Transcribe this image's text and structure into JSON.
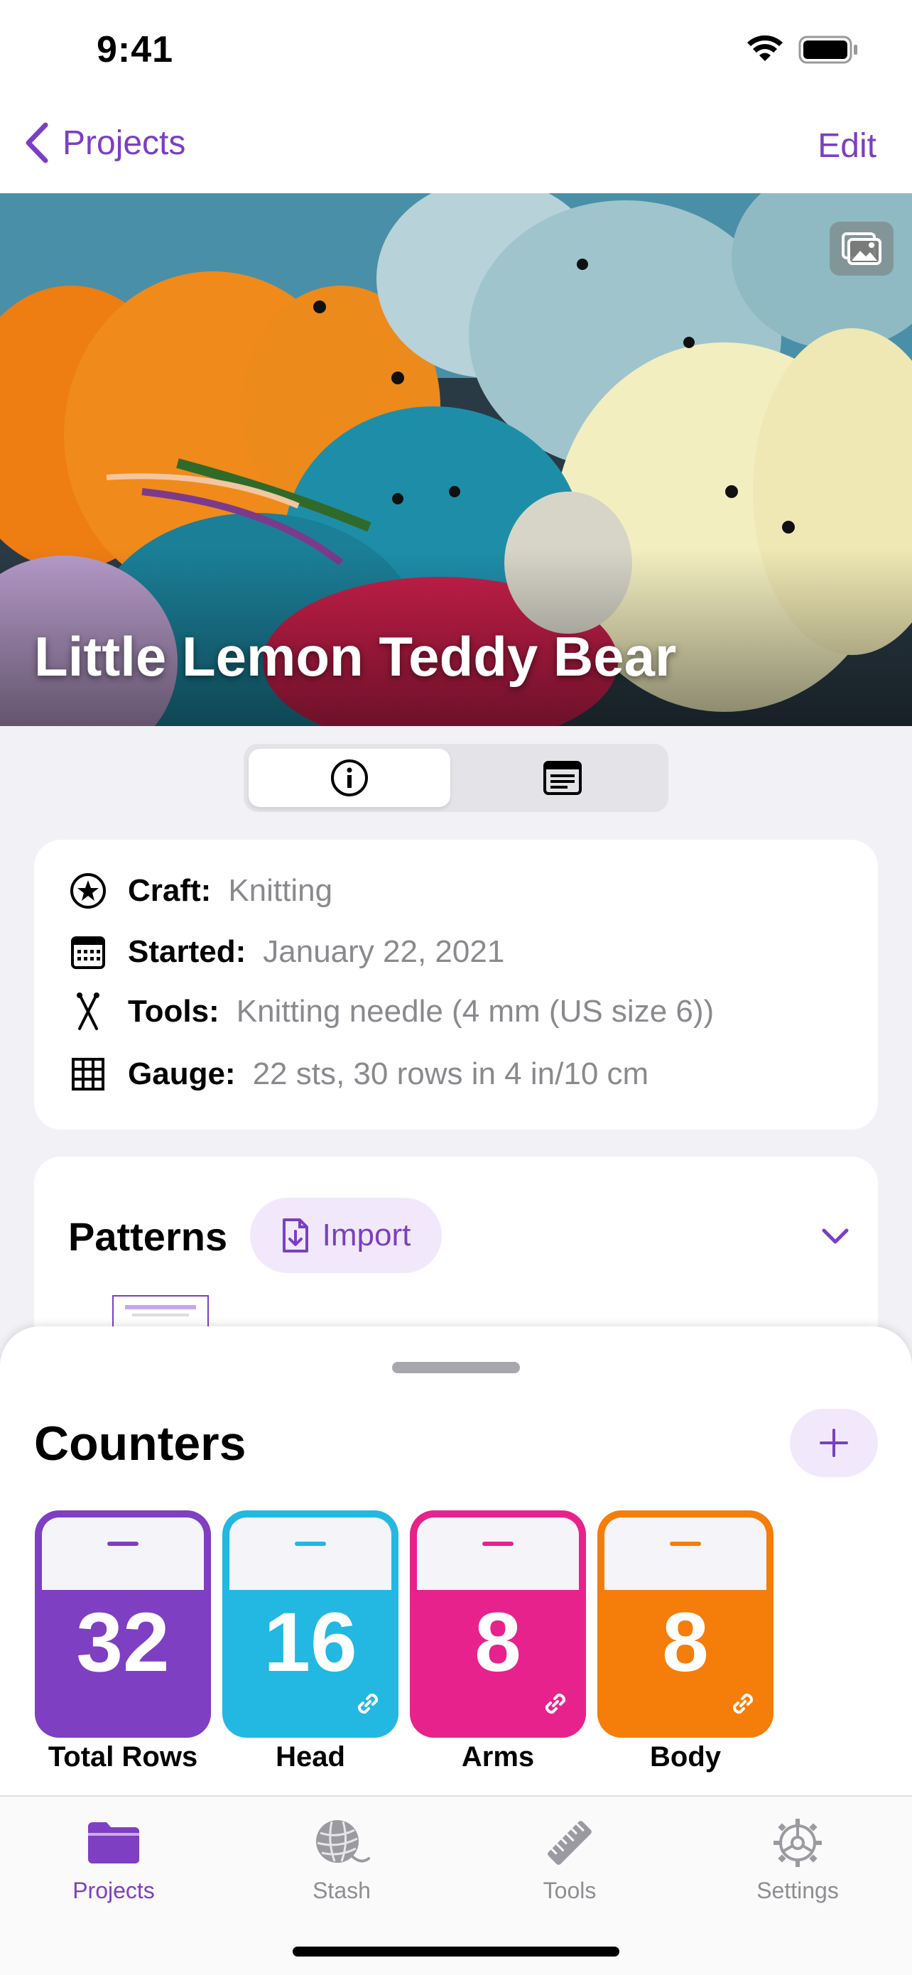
{
  "status_bar": {
    "time": "9:41"
  },
  "nav": {
    "back_label": "Projects",
    "edit_label": "Edit"
  },
  "hero": {
    "title": "Little Lemon Teddy Bear",
    "gallery_icon": "photos-icon"
  },
  "segments": [
    {
      "icon": "info-circle-icon",
      "selected": true
    },
    {
      "icon": "notes-icon",
      "selected": false
    }
  ],
  "details": {
    "craft": {
      "label": "Craft:",
      "value": "Knitting"
    },
    "started": {
      "label": "Started:",
      "value": "January 22, 2021"
    },
    "tools": {
      "label": "Tools:",
      "value": "Knitting needle (4 mm (US size 6))"
    },
    "gauge": {
      "label": "Gauge:",
      "value": "22 sts, 30 rows in 4 in/10 cm"
    }
  },
  "patterns": {
    "title": "Patterns",
    "import_label": "Import"
  },
  "counters": {
    "title": "Counters",
    "items": [
      {
        "value": "32",
        "label": "Total Rows",
        "color": "#7e3fc2"
      },
      {
        "value": "16",
        "label": "Head",
        "color": "#22b8e2"
      },
      {
        "value": "8",
        "label": "Arms",
        "color": "#e8228c"
      },
      {
        "value": "8",
        "label": "Body",
        "color": "#f57d0a"
      }
    ]
  },
  "tab_bar": {
    "active_color": "#7e3fc2",
    "inactive_color": "#8e8e93",
    "items": [
      {
        "label": "Projects",
        "icon": "folder-icon",
        "active": true
      },
      {
        "label": "Stash",
        "icon": "yarn-ball-icon",
        "active": false
      },
      {
        "label": "Tools",
        "icon": "ruler-icon",
        "active": false
      },
      {
        "label": "Settings",
        "icon": "gear-icon",
        "active": false
      }
    ]
  }
}
